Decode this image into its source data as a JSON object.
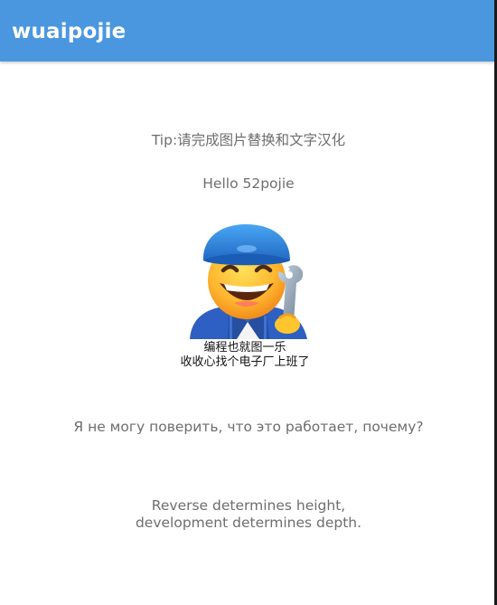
{
  "app_bar": {
    "title": "wuaipojie",
    "color": "#4a97e0"
  },
  "main": {
    "tip": "Tip:请完成图片替换和文字汉化",
    "hello": "Hello 52pojie",
    "image": {
      "icon": "mechanic-emoji-icon",
      "caption_line1": "编程也就图一乐",
      "caption_line2": "收收心找个电子厂上班了"
    },
    "russian_text": "Я не могу поверить, что это работает, почему?",
    "quote_line1": "Reverse determines height,",
    "quote_line2": "development determines depth."
  }
}
